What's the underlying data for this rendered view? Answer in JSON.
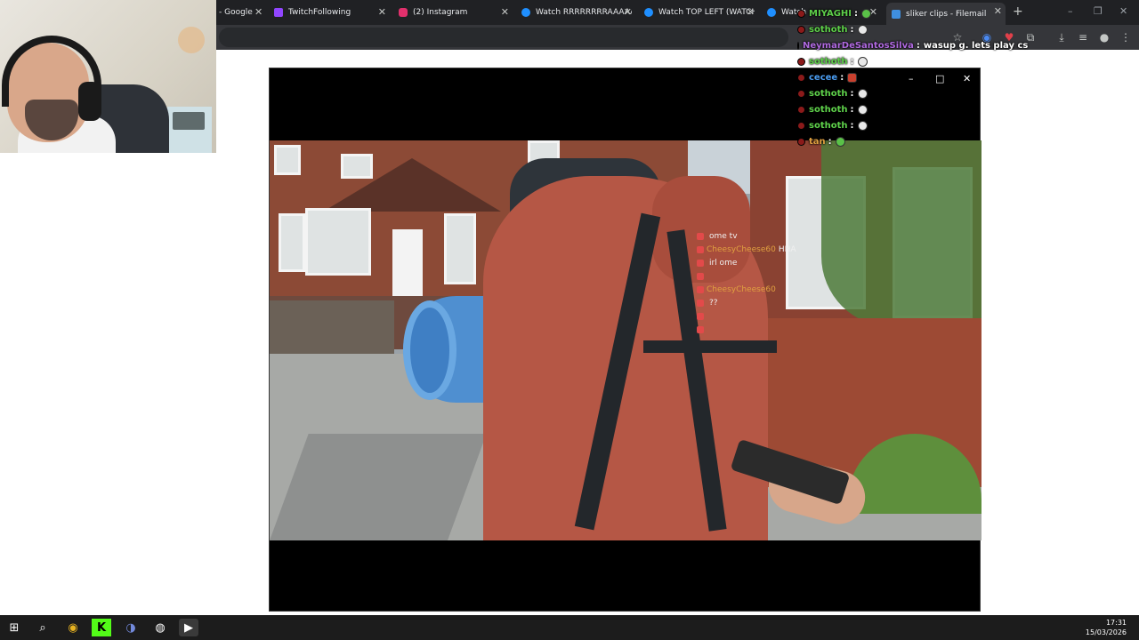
{
  "browser": {
    "tabs": [
      {
        "label": "- Google",
        "favicon": "google-docs-icon",
        "color": "#4285f4"
      },
      {
        "label": "TwitchFollowing",
        "favicon": "twitch-icon",
        "color": "#9146ff"
      },
      {
        "label": "(2) Instagram",
        "favicon": "instagram-icon",
        "color": "#e1306c"
      },
      {
        "label": "Watch RRRRRRRRAAAAAA",
        "favicon": "kick-icon",
        "color": "#1f8fff"
      },
      {
        "label": "Watch TOP LEFT (WATCH",
        "favicon": "kick-icon",
        "color": "#1f8fff"
      },
      {
        "label": "Watch",
        "favicon": "kick-icon",
        "color": "#1f8fff"
      },
      {
        "label": "sliker clips - Filemail",
        "favicon": "filemail-icon",
        "color": "#3f8fe0"
      }
    ],
    "active_tab_index": 6,
    "new_tab_label": "+"
  },
  "player": {
    "minimize_label": "–",
    "maximize_label": "□",
    "close_label": "✕"
  },
  "stream_overlay_chat": [
    {
      "name": "",
      "msg": "ome tv",
      "color": "#7aa0ff"
    },
    {
      "name": "CheesyCheese60",
      "msg": "HHA",
      "color": "#e0a040"
    },
    {
      "name": "",
      "msg": "irl ome",
      "color": "#e04a6a"
    },
    {
      "name": "",
      "msg": "",
      "color": "#b06ae0"
    },
    {
      "name": "CheesyCheese60",
      "msg": "",
      "color": "#e0a040"
    },
    {
      "name": "",
      "msg": "??",
      "color": "#4a8ae0"
    },
    {
      "name": "",
      "msg": "",
      "color": "#e04040"
    },
    {
      "name": "",
      "msg": "",
      "color": "#e04040"
    }
  ],
  "chat": [
    {
      "name": "MIYAGHI",
      "msg": "",
      "color": "#5ed04a",
      "emote": "green"
    },
    {
      "name": "sothoth",
      "msg": "",
      "color": "#5ed04a",
      "emote": "white"
    },
    {
      "name": "NeymarDeSantosSilva",
      "msg": "wasup g. lets play cs",
      "color": "#b06ae0",
      "emote": ""
    },
    {
      "name": "sothoth",
      "msg": "",
      "color": "#5ed04a",
      "emote": "white"
    },
    {
      "name": "cecee",
      "msg": "",
      "color": "#4a9cf0",
      "emote": "red"
    },
    {
      "name": "sothoth",
      "msg": "",
      "color": "#5ed04a",
      "emote": "white"
    },
    {
      "name": "sothoth",
      "msg": "",
      "color": "#5ed04a",
      "emote": "white"
    },
    {
      "name": "sothoth",
      "msg": "",
      "color": "#5ed04a",
      "emote": "white"
    },
    {
      "name": "tan",
      "msg": "",
      "color": "#e0a040",
      "emote": "green"
    }
  ],
  "taskbar": {
    "apps": [
      {
        "name": "windows-start-icon",
        "glyph": "⊞"
      },
      {
        "name": "search-icon",
        "glyph": "⌕"
      },
      {
        "name": "chrome-icon",
        "glyph": "◉"
      },
      {
        "name": "kick-app-icon",
        "glyph": "K"
      },
      {
        "name": "discord-icon",
        "glyph": "◑"
      },
      {
        "name": "obs-icon",
        "glyph": "◍"
      },
      {
        "name": "media-player-icon",
        "glyph": "▶"
      }
    ],
    "time": "17:31",
    "date": "15/03/2026"
  },
  "colors": {
    "browser_bg": "#202124",
    "toolbar_bg": "#35363a",
    "taskbar_bg": "#1c1c1c"
  }
}
